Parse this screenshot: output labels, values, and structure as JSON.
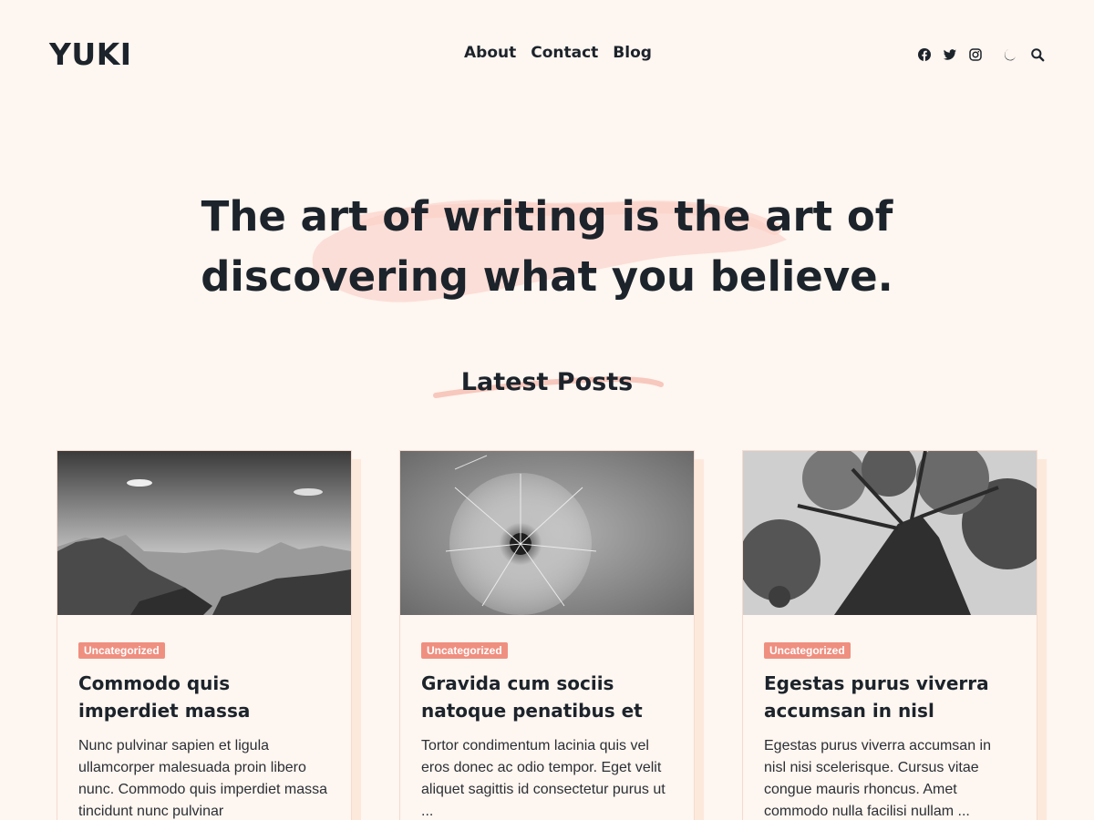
{
  "site": {
    "logo": "YUKI"
  },
  "nav": {
    "items": [
      "About",
      "Contact",
      "Blog"
    ]
  },
  "header_icons": [
    "facebook-icon",
    "twitter-icon",
    "instagram-icon",
    "moon-icon",
    "search-icon"
  ],
  "hero": {
    "quote": "The art of writing is the art of discovering what you believe."
  },
  "latest": {
    "title": "Latest Posts"
  },
  "colors": {
    "background": "#fef6f0",
    "accent": "#ef8f80",
    "brush": "#fbdcd4",
    "text": "#1c232b"
  },
  "posts": [
    {
      "category": "Uncategorized",
      "title": "Commodo quis imperdiet massa",
      "excerpt": "Nunc pulvinar sapien et ligula ullamcorper malesuada proin libero nunc. Commodo quis imperdiet massa tincidunt nunc pulvinar"
    },
    {
      "category": "Uncategorized",
      "title": "Gravida cum sociis natoque penatibus et",
      "excerpt": "Tortor condimentum lacinia quis vel eros donec ac odio tempor. Eget velit aliquet sagittis id consectetur purus ut ..."
    },
    {
      "category": "Uncategorized",
      "title": "Egestas purus viverra accumsan in nisl",
      "excerpt": "Egestas purus viverra accumsan in nisl nisi scelerisque. Cursus vitae congue mauris rhoncus. Amet commodo nulla facilisi nullam ..."
    }
  ]
}
